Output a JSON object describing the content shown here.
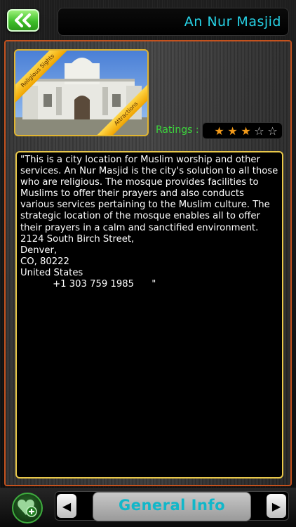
{
  "header": {
    "back_icon": "double-chevron-left-icon",
    "title": "An Nur Masjid"
  },
  "photo": {
    "ribbon_top": "Religious Sights",
    "ribbon_bottom": "Attractions"
  },
  "ratings": {
    "label": "Ratings :",
    "value": 3,
    "max": 5,
    "star_on_color": "#f29a1a",
    "star_off_color": "#cfcfcf"
  },
  "description": "\"This is a city location for Muslim worship and other services. An Nur Masjid is the city's solution to all those who are religious. The mosque provides facilities to Muslims to offer their prayers and also conducts various services pertaining to the Muslim culture. The strategic location of the mosque enables all to offer their prayers in a calm and sanctified environment.\n2124 South Birch Street,\nDenver,\nCO, 80222\nUnited States\n           +1 303 759 1985      \"",
  "bottom_bar": {
    "favorite_icon": "heart-add-icon",
    "prev_icon": "triangle-left-icon",
    "section_label": "General Info",
    "next_icon": "triangle-right-icon"
  },
  "colors": {
    "accent_cyan": "#27d2e6",
    "frame_orange": "#c4521e",
    "border_gold": "#e9c84a",
    "ratings_green": "#3cd53c"
  }
}
